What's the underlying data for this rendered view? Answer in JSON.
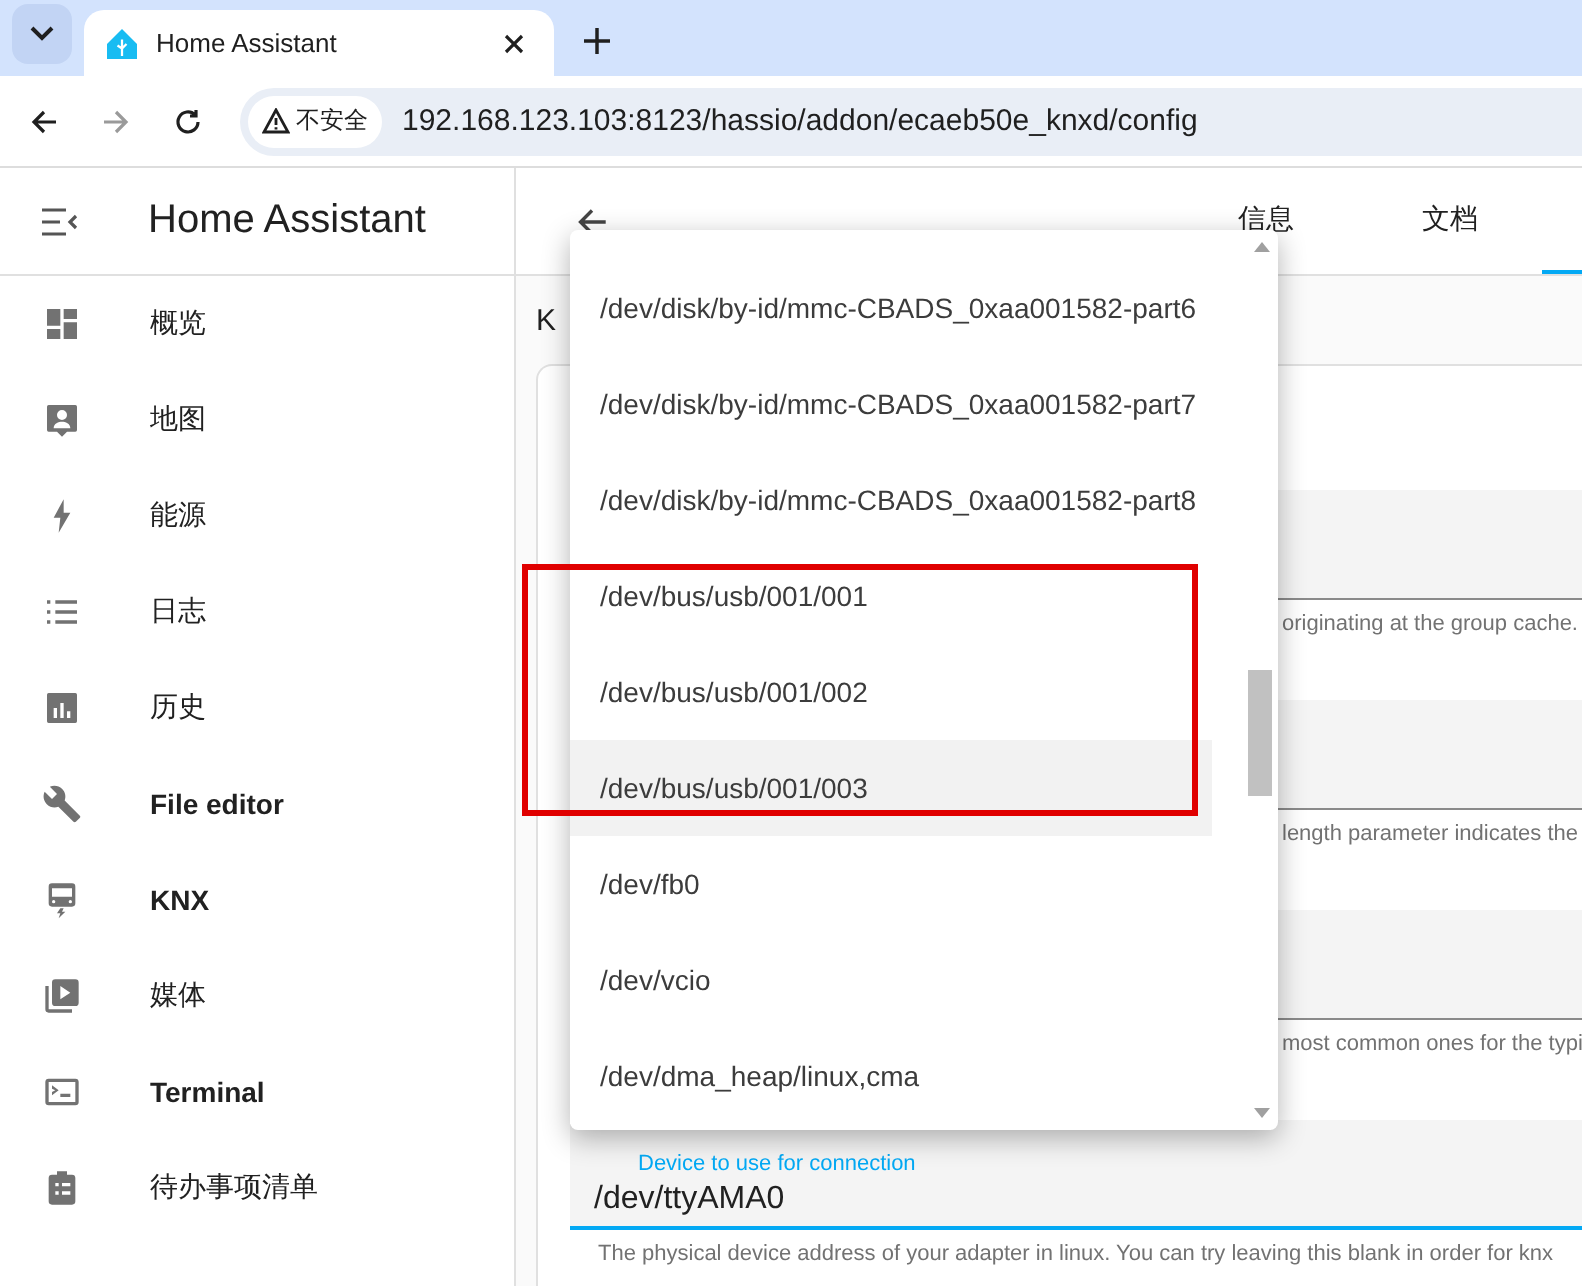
{
  "browser": {
    "tab_title": "Home Assistant",
    "security_label": "不安全",
    "url": "192.168.123.103:8123/hassio/addon/ecaeb50e_knxd/config"
  },
  "sidebar": {
    "title": "Home Assistant",
    "items": [
      {
        "label": "概览"
      },
      {
        "label": "地图"
      },
      {
        "label": "能源"
      },
      {
        "label": "日志"
      },
      {
        "label": "历史"
      },
      {
        "label": "File editor"
      },
      {
        "label": "KNX"
      },
      {
        "label": "媒体"
      },
      {
        "label": "Terminal"
      },
      {
        "label": "待办事项清单"
      }
    ]
  },
  "header": {
    "tabs": [
      {
        "label": "信息",
        "selected": false
      },
      {
        "label": "文档",
        "selected": false
      }
    ]
  },
  "section_heading": "K",
  "fields": [
    {
      "helper": "originating at the group cache."
    },
    {
      "helper": "length parameter indicates the"
    },
    {
      "helper": "most common ones for the typi"
    },
    {
      "label": "Device to use for connection",
      "value": "/dev/ttyAMA0",
      "focused": true,
      "helper": "The physical device address of your adapter in linux. You can try leaving this blank in order for knx"
    }
  ],
  "dropdown": {
    "options": [
      {
        "label": "/dev/disk/by-id/mmc-CBADS_0xaa001582-part6",
        "selected": false,
        "framed": false
      },
      {
        "label": "/dev/disk/by-id/mmc-CBADS_0xaa001582-part7",
        "selected": false,
        "framed": false
      },
      {
        "label": "/dev/disk/by-id/mmc-CBADS_0xaa001582-part8",
        "selected": false,
        "framed": false
      },
      {
        "label": "/dev/bus/usb/001/001",
        "selected": false,
        "framed": true
      },
      {
        "label": "/dev/bus/usb/001/002",
        "selected": false,
        "framed": true
      },
      {
        "label": "/dev/bus/usb/001/003",
        "selected": true,
        "framed": true
      },
      {
        "label": "/dev/fb0",
        "selected": false,
        "framed": false
      },
      {
        "label": "/dev/vcio",
        "selected": false,
        "framed": false
      },
      {
        "label": "/dev/dma_heap/linux,cma",
        "selected": false,
        "framed": false
      }
    ]
  }
}
